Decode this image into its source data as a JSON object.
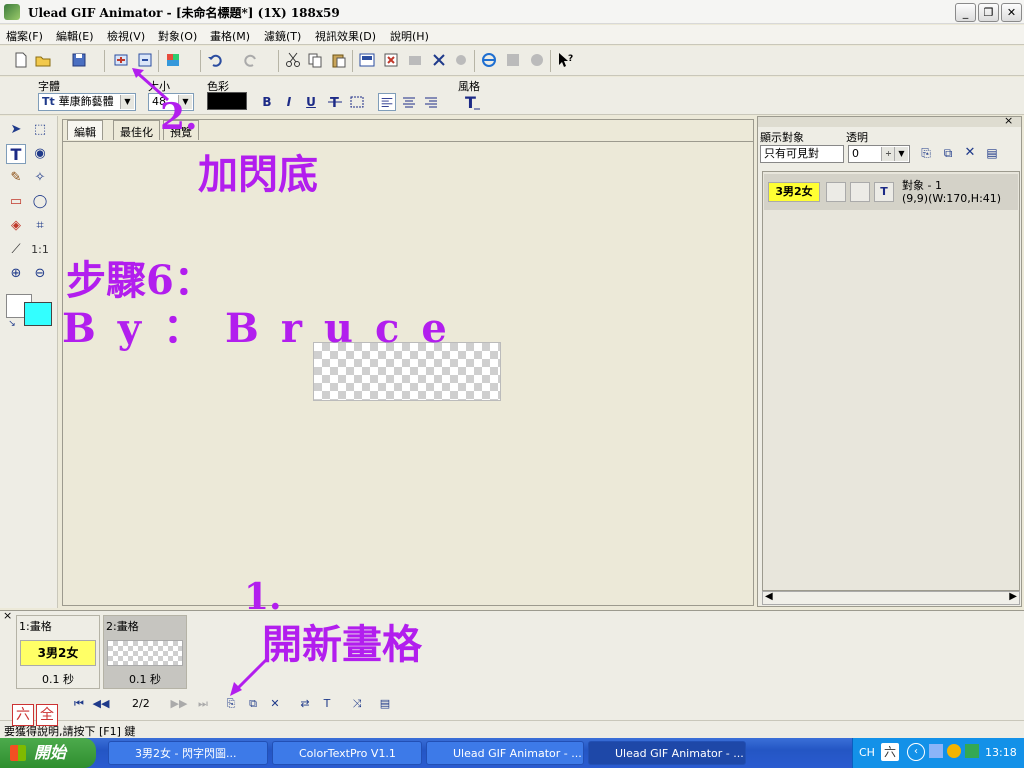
{
  "window": {
    "title": "Ulead GIF Animator - [未命名標題*] (1X) 188x59",
    "controls": {
      "minimize": "_",
      "restore": "❐",
      "close": "✕"
    }
  },
  "menu": {
    "file": "檔案(F)",
    "edit": "編輯(E)",
    "view": "檢視(V)",
    "object": "對象(O)",
    "frame": "畫格(M)",
    "filter": "濾鏡(T)",
    "effects": "視訊效果(D)",
    "help": "說明(H)"
  },
  "textbar": {
    "font_label": "字體",
    "font_value": "華康飾藝體",
    "size_label": "大小",
    "size_value": "48",
    "color_label": "色彩",
    "style_label": "風格",
    "color_value": "#000000",
    "bold": "B",
    "italic": "I",
    "underline": "U"
  },
  "workspace": {
    "tabs": [
      "編輯",
      "最佳化",
      "預覽"
    ],
    "canvas_size": "188x59"
  },
  "palette": {
    "fg_color": "#ffffff",
    "bg_color": "#33ffff"
  },
  "object_panel": {
    "show_label": "顯示對象",
    "show_value": "只有可見對",
    "opacity_label": "透明",
    "opacity_value": "0",
    "object_name": "對象 - 1",
    "object_geom": "(9,9)(W:170,H:41)",
    "object_thumb_text": "3男2女"
  },
  "frames": {
    "items": [
      {
        "label": "1:畫格",
        "thumb_text": "3男2女",
        "delay": "0.1 秒"
      },
      {
        "label": "2:畫格",
        "thumb_text": "",
        "delay": "0.1 秒"
      }
    ],
    "counter": "2/2"
  },
  "statusbar": {
    "text": "要獲得說明,請按下 [F1] 鍵",
    "ime_1": "六",
    "ime_2": "全"
  },
  "taskbar": {
    "start": "開始",
    "tasks": [
      "3男2女 - 閃字閃圖...",
      "ColorTextPro V1.1",
      "Ulead GIF Animator - ...",
      "Ulead GIF Animator - ..."
    ],
    "tray_lang": "CH",
    "tray_ime": "六",
    "clock": "13:18"
  },
  "annotations": {
    "step2_num": "2.",
    "step2_text": "加閃底",
    "step6": "步驟6：",
    "author": "By：Bruce",
    "step1_num": "1.",
    "step1_text": "開新畫格"
  }
}
